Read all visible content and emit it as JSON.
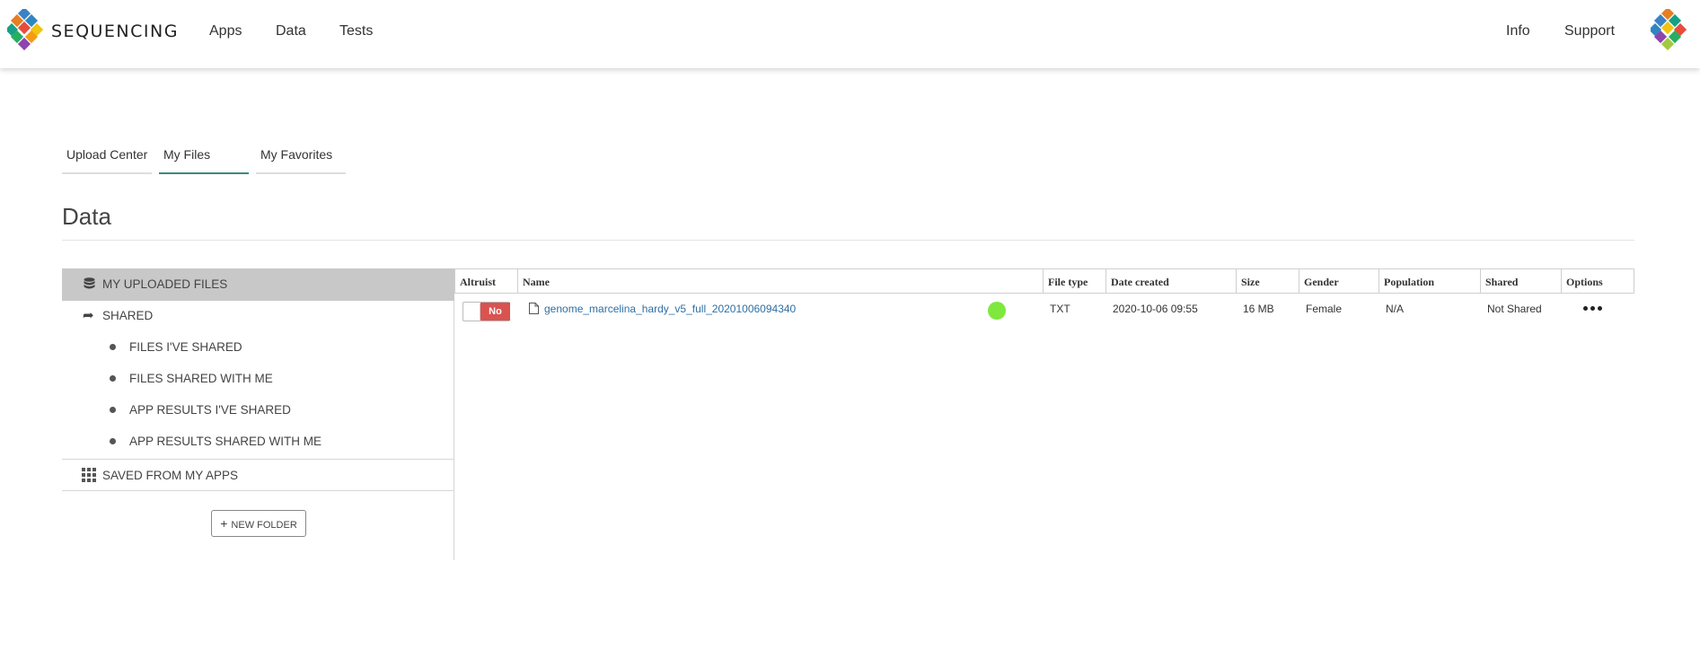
{
  "header": {
    "brand": "SEQUENCING",
    "nav_left": [
      "Apps",
      "Data",
      "Tests"
    ],
    "nav_right": [
      "Info",
      "Support"
    ]
  },
  "tabs": [
    {
      "label": "Upload Center",
      "active": false
    },
    {
      "label": "My Files",
      "active": true
    },
    {
      "label": "My Favorites",
      "active": false
    }
  ],
  "page": {
    "title": "Data"
  },
  "sidebar": {
    "uploaded": "MY UPLOADED FILES",
    "shared": "SHARED",
    "shared_items": [
      "FILES I'VE SHARED",
      "FILES SHARED WITH ME",
      "APP RESULTS I'VE SHARED",
      "APP RESULTS SHARED WITH ME"
    ],
    "saved": "SAVED FROM MY APPS",
    "new_folder": "NEW FOLDER"
  },
  "table": {
    "columns": [
      "Altruist",
      "Name",
      "File type",
      "Date created",
      "Size",
      "Gender",
      "Population",
      "Shared",
      "Options"
    ],
    "rows": [
      {
        "altruist": "No",
        "name": "genome_marcelina_hardy_v5_full_20201006094340",
        "file_type": "TXT",
        "date_created": "2020-10-06 09:55",
        "size": "16 MB",
        "gender": "Female",
        "population": "N/A",
        "shared": "Not Shared",
        "status_color": "#7ee83e"
      }
    ]
  },
  "colors": {
    "active_tab": "#3a8a7e",
    "link": "#2f6fa3",
    "toggle_off": "#d9534f",
    "sidebar_active": "#c8c8c8"
  }
}
